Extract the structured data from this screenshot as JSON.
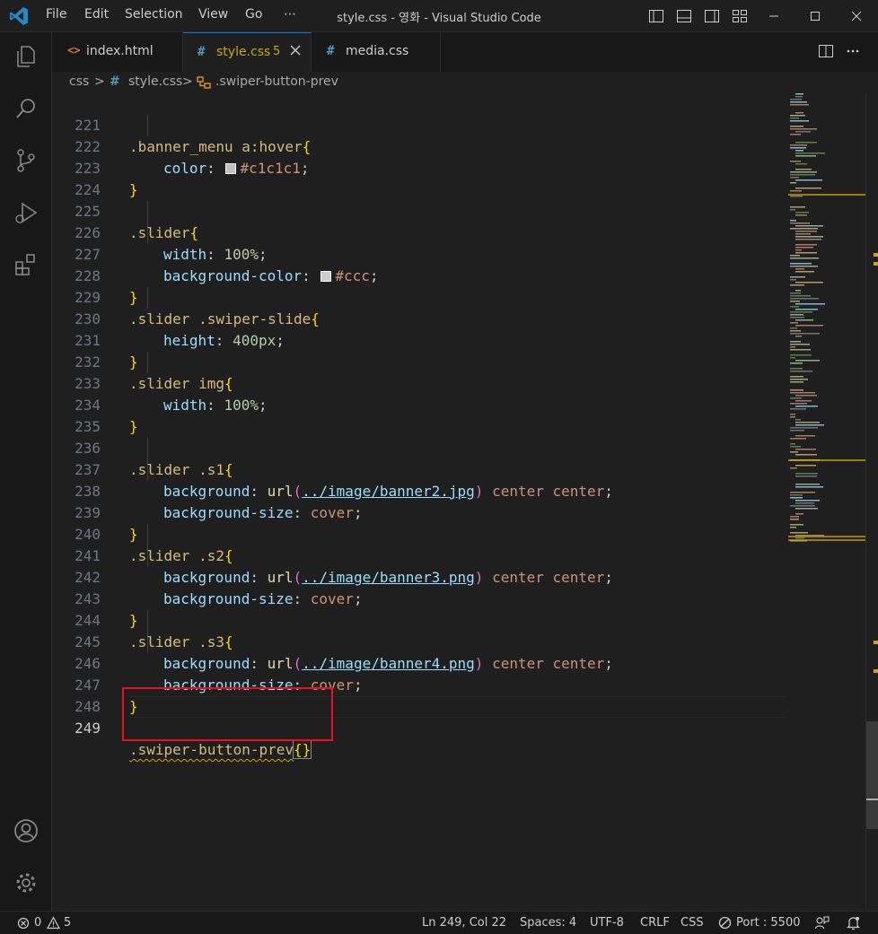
{
  "titlebar": {
    "menu": [
      "File",
      "Edit",
      "Selection",
      "View",
      "Go",
      "⋯"
    ],
    "title": "style.css - 영화 - Visual Studio Code"
  },
  "tabs": [
    {
      "icon": "<>",
      "label": "index.html",
      "icon_color": "#e37933"
    },
    {
      "icon": "#",
      "label": "style.css",
      "badge": "5",
      "icon_color": "#519aba",
      "active": true
    },
    {
      "icon": "#",
      "label": "media.css",
      "icon_color": "#519aba"
    }
  ],
  "breadcrumb": {
    "folder": "css",
    "file_icon": "#",
    "file": "style.css",
    "symbol": ".swiper-button-prev",
    "sep": ">"
  },
  "editor": {
    "line_numbers": [
      "221",
      "222",
      "223",
      "224",
      "225",
      "226",
      "227",
      "228",
      "229",
      "230",
      "231",
      "232",
      "233",
      "234",
      "235",
      "236",
      "237",
      "238",
      "239",
      "240",
      "241",
      "242",
      "243",
      "244",
      "245",
      "246",
      "247",
      "248",
      "249"
    ],
    "tokens": {
      "banner_menu_sel": ".banner_menu a:hover",
      "slider_sel": ".slider",
      "slider_slide_sel": ".slider .swiper-slide",
      "slider_img_sel": ".slider img",
      "s1_sel": ".slider .s1",
      "s2_sel": ".slider .s2",
      "s3_sel": ".slider .s3",
      "swiper_prev_sel": ".swiper-button-prev",
      "open_brace": "{",
      "close_brace": "}",
      "color_prop": "color",
      "width_prop": "width",
      "bgcolor_prop": "background-color",
      "height_prop": "height",
      "bg_prop": "background",
      "bgsize_prop": "background-size",
      "colon": ": ",
      "semi": ";",
      "color_val": "#c1c1c1",
      "ccc_val": "#ccc",
      "pct100": "100%",
      "px400": "400px",
      "url_fn": "url",
      "lparen": "(",
      "rparen": ")",
      "path2": "../image/banner2.jpg",
      "path3": "../image/banner3.png",
      "path4": "../image/banner4.png",
      "center_center": " center center",
      "cover": "cover",
      "empty_braces": "{}"
    }
  },
  "statusbar": {
    "errors": "0",
    "warnings": "5",
    "position": "Ln 249, Col 22",
    "spaces": "Spaces: 4",
    "encoding": "UTF-8",
    "eol": "CRLF",
    "language": "CSS",
    "port": "Port : 5500"
  },
  "colors": {
    "accent": "#0078d4",
    "highlight_box": "#e81123",
    "warning": "#cca700"
  }
}
